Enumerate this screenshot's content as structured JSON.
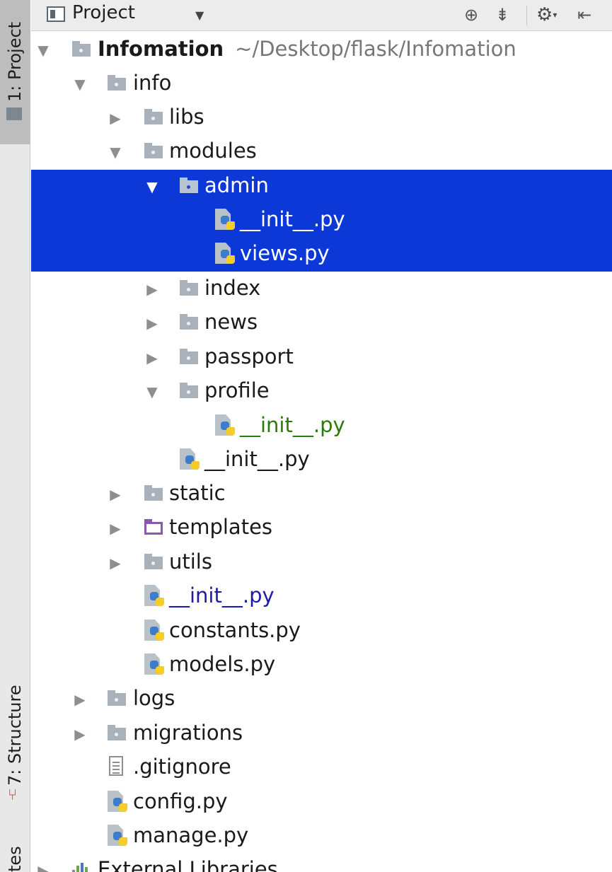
{
  "stripe": {
    "project_label": "1: Project",
    "structure_label": "7: Structure",
    "favorites_label": "tes"
  },
  "header": {
    "title": "Project",
    "icons": [
      "project-view-icon",
      "dropdown-arrow-icon",
      "locate-target-icon",
      "collapse-all-icon",
      "gear-icon",
      "hide-panel-icon"
    ]
  },
  "tree": {
    "root_name": "Infomation",
    "root_path": "~/Desktop/flask/Infomation",
    "info": "info",
    "libs": "libs",
    "modules": "modules",
    "admin": "admin",
    "admin_init": "__init__.py",
    "admin_views": "views.py",
    "index": "index",
    "news": "news",
    "passport": "passport",
    "profile": "profile",
    "profile_init": "__init__.py",
    "modules_init": "__init__.py",
    "static": "static",
    "templates": "templates",
    "utils": "utils",
    "info_init": "__init__.py",
    "constants": "constants.py",
    "models": "models.py",
    "logs": "logs",
    "migrations": "migrations",
    "gitignore": ".gitignore",
    "config": "config.py",
    "manage": "manage.py",
    "external": "External Libraries"
  },
  "colors": {
    "selection": "#0d38d8",
    "modified_green": "#2a7c0a",
    "changed_blue": "#1c1ca8",
    "templates_purple": "#8a5aa8"
  }
}
